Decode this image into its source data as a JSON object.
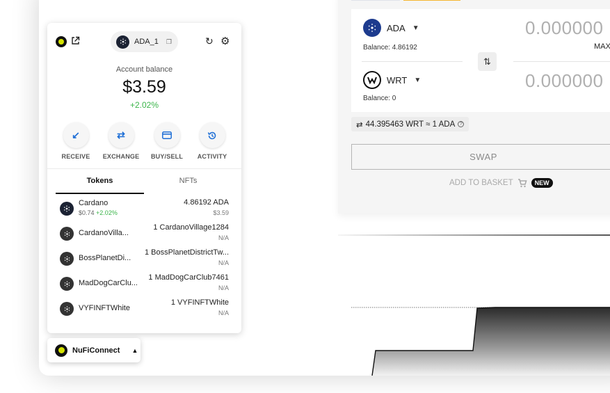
{
  "swap": {
    "from": {
      "token": "ADA",
      "balance": "Balance: 4.86192",
      "amount": "0.000000",
      "max_label": "MAX"
    },
    "to": {
      "token": "WRT",
      "balance": "Balance: 0",
      "amount": "0.000000"
    },
    "rate": "44.395463 WRT ≈ 1 ADA",
    "swap_label": "SWAP",
    "basket_label": "ADD TO BASKET",
    "new_badge": "NEW"
  },
  "wallet": {
    "account_name": "ADA_1",
    "balance_label": "Account balance",
    "balance_value": "$3.59",
    "balance_change": "+2.02%",
    "actions": [
      {
        "label": "RECEIVE",
        "icon": "arrow-down-left-icon"
      },
      {
        "label": "EXCHANGE",
        "icon": "swap-icon"
      },
      {
        "label": "BUY/SELL",
        "icon": "card-icon"
      },
      {
        "label": "ACTIVITY",
        "icon": "history-icon"
      }
    ],
    "tabs": [
      "Tokens",
      "NFTs"
    ],
    "tokens": [
      {
        "name": "Cardano",
        "price": "$0.74",
        "change": "+2.02%",
        "amount": "4.86192 ADA",
        "usd": "$3.59"
      },
      {
        "name": "CardanoVilla...",
        "amount": "1 CardanoVillage1284",
        "usd": "N/A"
      },
      {
        "name": "BossPlanetDi...",
        "amount": "1 BossPlanetDistrictTw...",
        "usd": "N/A"
      },
      {
        "name": "MadDogCarClu...",
        "amount": "1 MadDogCarClub7461",
        "usd": "N/A"
      },
      {
        "name": "VYFINFTWhite",
        "amount": "1 VYFINFTWhite",
        "usd": "N/A"
      }
    ]
  },
  "connect": {
    "label": "NuFiConnect"
  },
  "colors": {
    "accent": "#1f6fd6",
    "positive": "#3bb54a",
    "brand": "#d4e300",
    "warning": "#f5b630"
  }
}
